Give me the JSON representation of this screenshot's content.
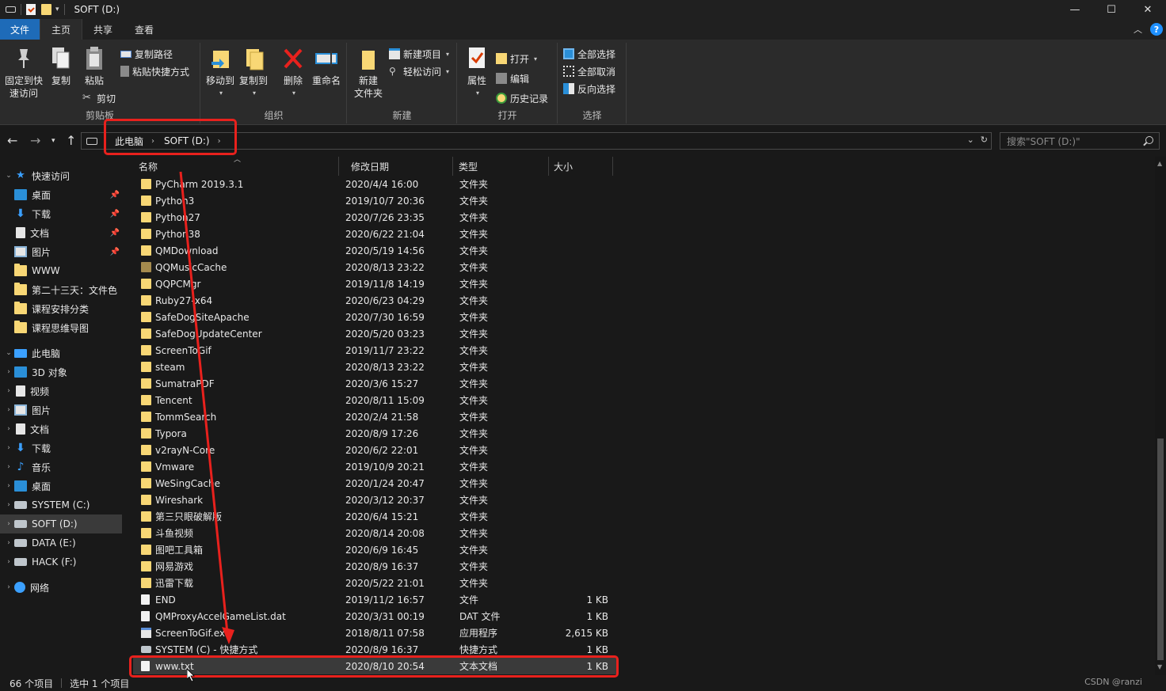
{
  "window": {
    "title": "SOFT (D:)",
    "minimize_glyph": "—",
    "maximize_glyph": "☐",
    "close_glyph": "✕"
  },
  "tabs": [
    {
      "label": "文件"
    },
    {
      "label": "主页"
    },
    {
      "label": "共享"
    },
    {
      "label": "查看"
    }
  ],
  "ribbon": {
    "pin_label_1": "固定到快",
    "pin_label_2": "速访问",
    "copy_label": "复制",
    "paste_label": "粘贴",
    "copy_path_label": "复制路径",
    "paste_shortcut_label": "粘贴快捷方式",
    "cut_label": "剪切",
    "group_clipboard": "剪贴板",
    "move_to_label": "移动到",
    "copy_to_label": "复制到",
    "delete_label": "删除",
    "rename_label": "重命名",
    "group_organize": "组织",
    "new_folder_label_1": "新建",
    "new_folder_label_2": "文件夹",
    "new_item_label": "新建项目",
    "easy_access_label": "轻松访问",
    "group_new": "新建",
    "properties_label": "属性",
    "open_label": "打开",
    "edit_label": "编辑",
    "history_label": "历史记录",
    "group_open": "打开",
    "select_all_label": "全部选择",
    "select_none_label": "全部取消",
    "invert_selection_label": "反向选择",
    "group_select": "选择"
  },
  "address": {
    "crumbs": [
      "此电脑",
      "SOFT (D:)"
    ],
    "search_placeholder": "搜索\"SOFT (D:)\""
  },
  "navpane": {
    "quick_access": "快速访问",
    "quick_items": [
      {
        "label": "桌面",
        "icon": "desktop-icon",
        "pinned": true
      },
      {
        "label": "下载",
        "icon": "download-icon",
        "pinned": true
      },
      {
        "label": "文档",
        "icon": "document-icon",
        "pinned": true
      },
      {
        "label": "图片",
        "icon": "picture-icon",
        "pinned": true
      },
      {
        "label": "WWW",
        "icon": "folder-icon",
        "pinned": false
      },
      {
        "label": "第二十三天：文件色",
        "icon": "folder-icon",
        "pinned": false
      },
      {
        "label": "课程安排分类",
        "icon": "folder-icon",
        "pinned": false
      },
      {
        "label": "课程思维导图",
        "icon": "folder-icon",
        "pinned": false
      }
    ],
    "this_pc": "此电脑",
    "pc_items": [
      {
        "label": "3D 对象",
        "icon": "3d-objects-icon"
      },
      {
        "label": "视频",
        "icon": "video-icon"
      },
      {
        "label": "图片",
        "icon": "picture-icon"
      },
      {
        "label": "文档",
        "icon": "document-icon"
      },
      {
        "label": "下载",
        "icon": "download-icon"
      },
      {
        "label": "音乐",
        "icon": "music-icon"
      },
      {
        "label": "桌面",
        "icon": "desktop-icon"
      },
      {
        "label": "SYSTEM (C:)",
        "icon": "drive-icon"
      },
      {
        "label": "SOFT (D:)",
        "icon": "drive-icon"
      },
      {
        "label": "DATA (E:)",
        "icon": "drive-icon"
      },
      {
        "label": "HACK (F:)",
        "icon": "drive-icon"
      }
    ],
    "network": "网络"
  },
  "columns": {
    "name": "名称",
    "date": "修改日期",
    "type": "类型",
    "size": "大小"
  },
  "files": [
    {
      "name": "PyCharm 2019.3.1",
      "date": "2020/4/4 16:00",
      "type": "文件夹",
      "size": "",
      "kind": "folder"
    },
    {
      "name": "Python3",
      "date": "2019/10/7 20:36",
      "type": "文件夹",
      "size": "",
      "kind": "folder"
    },
    {
      "name": "Python27",
      "date": "2020/7/26 23:35",
      "type": "文件夹",
      "size": "",
      "kind": "folder"
    },
    {
      "name": "Python38",
      "date": "2020/6/22 21:04",
      "type": "文件夹",
      "size": "",
      "kind": "folder"
    },
    {
      "name": "QMDownload",
      "date": "2020/5/19 14:56",
      "type": "文件夹",
      "size": "",
      "kind": "folder"
    },
    {
      "name": "QQMusicCache",
      "date": "2020/8/13 23:22",
      "type": "文件夹",
      "size": "",
      "kind": "folder-dim"
    },
    {
      "name": "QQPCMgr",
      "date": "2019/11/8 14:19",
      "type": "文件夹",
      "size": "",
      "kind": "folder"
    },
    {
      "name": "Ruby27-x64",
      "date": "2020/6/23 04:29",
      "type": "文件夹",
      "size": "",
      "kind": "folder"
    },
    {
      "name": "SafeDogSiteApache",
      "date": "2020/7/30 16:59",
      "type": "文件夹",
      "size": "",
      "kind": "folder"
    },
    {
      "name": "SafeDogUpdateCenter",
      "date": "2020/5/20 03:23",
      "type": "文件夹",
      "size": "",
      "kind": "folder"
    },
    {
      "name": "ScreenToGif",
      "date": "2019/11/7 23:22",
      "type": "文件夹",
      "size": "",
      "kind": "folder"
    },
    {
      "name": "steam",
      "date": "2020/8/13 23:22",
      "type": "文件夹",
      "size": "",
      "kind": "folder"
    },
    {
      "name": "SumatraPDF",
      "date": "2020/3/6 15:27",
      "type": "文件夹",
      "size": "",
      "kind": "folder"
    },
    {
      "name": "Tencent",
      "date": "2020/8/11 15:09",
      "type": "文件夹",
      "size": "",
      "kind": "folder"
    },
    {
      "name": "TommSearch",
      "date": "2020/2/4 21:58",
      "type": "文件夹",
      "size": "",
      "kind": "folder"
    },
    {
      "name": "Typora",
      "date": "2020/8/9 17:26",
      "type": "文件夹",
      "size": "",
      "kind": "folder"
    },
    {
      "name": "v2rayN-Core",
      "date": "2020/6/2 22:01",
      "type": "文件夹",
      "size": "",
      "kind": "folder"
    },
    {
      "name": "Vmware",
      "date": "2019/10/9 20:21",
      "type": "文件夹",
      "size": "",
      "kind": "folder"
    },
    {
      "name": "WeSingCache",
      "date": "2020/1/24 20:47",
      "type": "文件夹",
      "size": "",
      "kind": "folder"
    },
    {
      "name": "Wireshark",
      "date": "2020/3/12 20:37",
      "type": "文件夹",
      "size": "",
      "kind": "folder"
    },
    {
      "name": "第三只眼破解版",
      "date": "2020/6/4 15:21",
      "type": "文件夹",
      "size": "",
      "kind": "folder"
    },
    {
      "name": "斗鱼视频",
      "date": "2020/8/14 20:08",
      "type": "文件夹",
      "size": "",
      "kind": "folder"
    },
    {
      "name": "图吧工具箱",
      "date": "2020/6/9 16:45",
      "type": "文件夹",
      "size": "",
      "kind": "folder"
    },
    {
      "name": "网易游戏",
      "date": "2020/8/9 16:37",
      "type": "文件夹",
      "size": "",
      "kind": "folder"
    },
    {
      "name": "迅雷下载",
      "date": "2020/5/22 21:01",
      "type": "文件夹",
      "size": "",
      "kind": "folder"
    },
    {
      "name": "END",
      "date": "2019/11/2 16:57",
      "type": "文件",
      "size": "1 KB",
      "kind": "file"
    },
    {
      "name": "QMProxyAccelGameList.dat",
      "date": "2020/3/31 00:19",
      "type": "DAT 文件",
      "size": "1 KB",
      "kind": "file"
    },
    {
      "name": "ScreenToGif.exe",
      "date": "2018/8/11 07:58",
      "type": "应用程序",
      "size": "2,615 KB",
      "kind": "exe"
    },
    {
      "name": "SYSTEM (C) - 快捷方式",
      "date": "2020/8/9 16:37",
      "type": "快捷方式",
      "size": "1 KB",
      "kind": "lnk"
    },
    {
      "name": "www.txt",
      "date": "2020/8/10 20:54",
      "type": "文本文档",
      "size": "1 KB",
      "kind": "file",
      "selected": true
    }
  ],
  "status": {
    "count": "66 个项目",
    "selected": "选中 1 个项目"
  },
  "watermark": "CSDN @ranzi",
  "colors": {
    "accent": "#1e6bb8",
    "folder": "#f8d775",
    "annotation": "#e8211d"
  }
}
